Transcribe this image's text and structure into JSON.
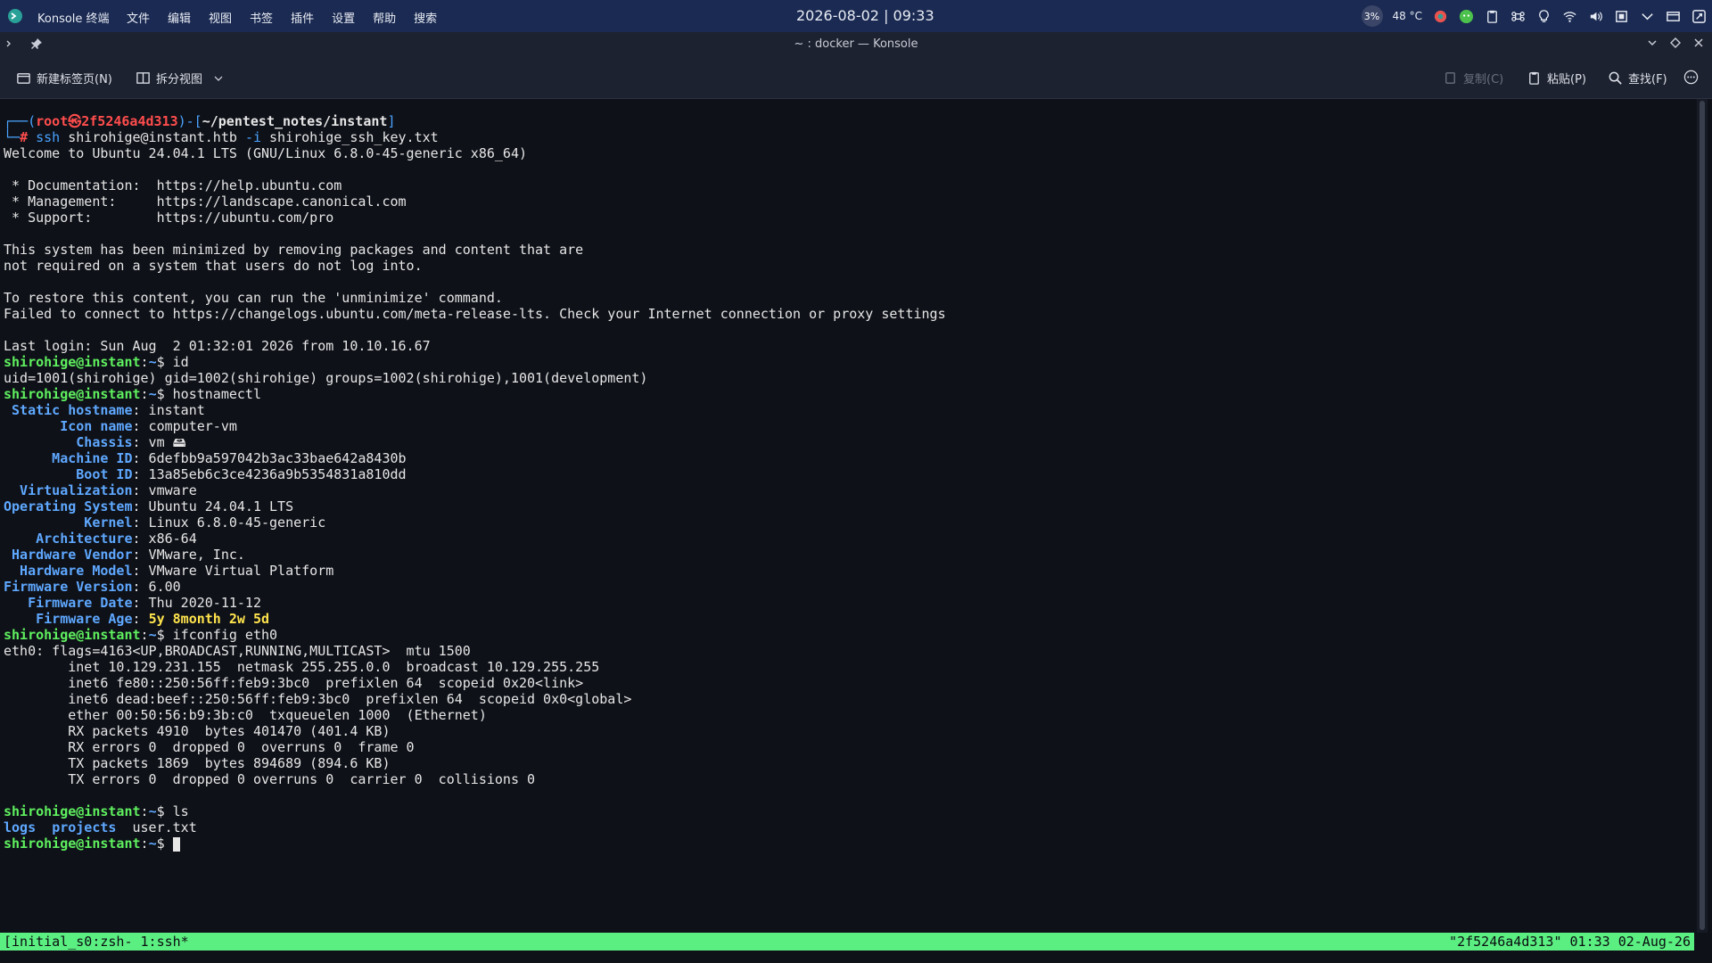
{
  "topbar": {
    "app_name": "Konsole 终端",
    "menus": [
      "文件",
      "编辑",
      "视图",
      "书签",
      "插件",
      "设置",
      "帮助",
      "搜索"
    ],
    "clock": "2026-08-02 | 09:33",
    "cpu": "3%",
    "temp": "48 °C",
    "tray_icons": [
      "color-picker-icon",
      "cat-icon",
      "clipboard-icon",
      "command-icon",
      "lightbulb-icon",
      "wifi-icon",
      "volume-icon",
      "chip-icon",
      "chevron-down-icon",
      "window-icon",
      "screenshot-icon"
    ]
  },
  "window": {
    "title": "~ : docker — Konsole"
  },
  "toolbar": {
    "new_tab": "新建标签页(N)",
    "split_view": "拆分视图",
    "copy": "复制(C)",
    "paste": "粘贴(P)",
    "find": "查找(F)"
  },
  "terminal": {
    "lines": [
      [
        [
          "c-blue",
          "┌──("
        ],
        [
          "c-red bold",
          "root㉿2f5246a4d313"
        ],
        [
          "c-blue",
          ")-["
        ],
        [
          "c-white bold",
          "~/pentest_notes/instant"
        ],
        [
          "c-blue",
          "]"
        ]
      ],
      [
        [
          "c-blue",
          "└─"
        ],
        [
          "c-red bold",
          "# "
        ],
        [
          "c-blue",
          "ssh "
        ],
        [
          "c-white",
          "shirohige@instant.htb "
        ],
        [
          "c-blue",
          "-i "
        ],
        [
          "c-white",
          "shirohige_ssh_key.txt"
        ]
      ],
      [
        [
          "c-white",
          "Welcome to Ubuntu 24.04.1 LTS (GNU/Linux 6.8.0-45-generic x86_64)"
        ]
      ],
      [
        [
          "c-white",
          ""
        ]
      ],
      [
        [
          "c-white",
          " * Documentation:  https://help.ubuntu.com"
        ]
      ],
      [
        [
          "c-white",
          " * Management:     https://landscape.canonical.com"
        ]
      ],
      [
        [
          "c-white",
          " * Support:        https://ubuntu.com/pro"
        ]
      ],
      [
        [
          "c-white",
          ""
        ]
      ],
      [
        [
          "c-white",
          "This system has been minimized by removing packages and content that are"
        ]
      ],
      [
        [
          "c-white",
          "not required on a system that users do not log into."
        ]
      ],
      [
        [
          "c-white",
          ""
        ]
      ],
      [
        [
          "c-white",
          "To restore this content, you can run the 'unminimize' command."
        ]
      ],
      [
        [
          "c-white",
          "Failed to connect to https://changelogs.ubuntu.com/meta-release-lts. Check your Internet connection or proxy settings"
        ]
      ],
      [
        [
          "c-white",
          ""
        ]
      ],
      [
        [
          "c-white",
          "Last login: Sun Aug  2 01:32:01 2026 from 10.10.16.67"
        ]
      ],
      [
        [
          "c-green",
          "shirohige@instant"
        ],
        [
          "c-white",
          ":"
        ],
        [
          "c-lblue",
          "~"
        ],
        [
          "c-white",
          "$ id"
        ]
      ],
      [
        [
          "c-white",
          "uid=1001(shirohige) gid=1002(shirohige) groups=1002(shirohige),1001(development)"
        ]
      ],
      [
        [
          "c-green",
          "shirohige@instant"
        ],
        [
          "c-white",
          ":"
        ],
        [
          "c-lblue",
          "~"
        ],
        [
          "c-white",
          "$ hostnamectl"
        ]
      ],
      [
        [
          "c-lblue",
          " Static hostname"
        ],
        [
          "c-white",
          ": instant"
        ]
      ],
      [
        [
          "c-lblue",
          "       Icon name"
        ],
        [
          "c-white",
          ": computer-vm"
        ]
      ],
      [
        [
          "c-lblue",
          "         Chassis"
        ],
        [
          "c-white",
          ": vm 🖴"
        ]
      ],
      [
        [
          "c-lblue",
          "      Machine ID"
        ],
        [
          "c-white",
          ": 6defbb9a597042b3ac33bae642a8430b"
        ]
      ],
      [
        [
          "c-lblue",
          "         Boot ID"
        ],
        [
          "c-white",
          ": 13a85eb6c3ce4236a9b5354831a810dd"
        ]
      ],
      [
        [
          "c-lblue",
          "  Virtualization"
        ],
        [
          "c-white",
          ": vmware"
        ]
      ],
      [
        [
          "c-lblue",
          "Operating System"
        ],
        [
          "c-white",
          ": Ubuntu 24.04.1 LTS"
        ]
      ],
      [
        [
          "c-lblue",
          "          Kernel"
        ],
        [
          "c-white",
          ": Linux 6.8.0-45-generic"
        ]
      ],
      [
        [
          "c-lblue",
          "    Architecture"
        ],
        [
          "c-white",
          ": x86-64"
        ]
      ],
      [
        [
          "c-lblue",
          " Hardware Vendor"
        ],
        [
          "c-white",
          ": VMware, Inc."
        ]
      ],
      [
        [
          "c-lblue",
          "  Hardware Model"
        ],
        [
          "c-white",
          ": VMware Virtual Platform"
        ]
      ],
      [
        [
          "c-lblue",
          "Firmware Version"
        ],
        [
          "c-white",
          ": 6.00"
        ]
      ],
      [
        [
          "c-lblue",
          "   Firmware Date"
        ],
        [
          "c-white",
          ": Thu 2020-11-12"
        ]
      ],
      [
        [
          "c-lblue",
          "    Firmware Age"
        ],
        [
          "c-white",
          ": "
        ],
        [
          "c-yellow",
          "5y 8month 2w 5d"
        ]
      ],
      [
        [
          "c-green",
          "shirohige@instant"
        ],
        [
          "c-white",
          ":"
        ],
        [
          "c-lblue",
          "~"
        ],
        [
          "c-white",
          "$ ifconfig eth0"
        ]
      ],
      [
        [
          "c-white",
          "eth0: flags=4163<UP,BROADCAST,RUNNING,MULTICAST>  mtu 1500"
        ]
      ],
      [
        [
          "c-white",
          "        inet 10.129.231.155  netmask 255.255.0.0  broadcast 10.129.255.255"
        ]
      ],
      [
        [
          "c-white",
          "        inet6 fe80::250:56ff:feb9:3bc0  prefixlen 64  scopeid 0x20<link>"
        ]
      ],
      [
        [
          "c-white",
          "        inet6 dead:beef::250:56ff:feb9:3bc0  prefixlen 64  scopeid 0x0<global>"
        ]
      ],
      [
        [
          "c-white",
          "        ether 00:50:56:b9:3b:c0  txqueuelen 1000  (Ethernet)"
        ]
      ],
      [
        [
          "c-white",
          "        RX packets 4910  bytes 401470 (401.4 KB)"
        ]
      ],
      [
        [
          "c-white",
          "        RX errors 0  dropped 0  overruns 0  frame 0"
        ]
      ],
      [
        [
          "c-white",
          "        TX packets 1869  bytes 894689 (894.6 KB)"
        ]
      ],
      [
        [
          "c-white",
          "        TX errors 0  dropped 0 overruns 0  carrier 0  collisions 0"
        ]
      ],
      [
        [
          "c-white",
          ""
        ]
      ],
      [
        [
          "c-green",
          "shirohige@instant"
        ],
        [
          "c-white",
          ":"
        ],
        [
          "c-lblue",
          "~"
        ],
        [
          "c-white",
          "$ ls"
        ]
      ],
      [
        [
          "c-lblue",
          "logs"
        ],
        [
          "c-white",
          "  "
        ],
        [
          "c-lblue",
          "projects"
        ],
        [
          "c-white",
          "  user.txt"
        ]
      ],
      [
        [
          "c-green",
          "shirohige@instant"
        ],
        [
          "c-white",
          ":"
        ],
        [
          "c-lblue",
          "~"
        ],
        [
          "c-white",
          "$ "
        ]
      ]
    ]
  },
  "statusbar": {
    "left": "[initial_s0:zsh- 1:ssh*",
    "right": "\"2f5246a4d313\" 01:33 02-Aug-26"
  },
  "colors": {
    "topbar": "#1b2a52",
    "terminal_bg": "#0e1118",
    "status_green": "#5bef82",
    "prompt_green": "#5ff05f",
    "label_blue": "#5fa8ff",
    "root_red": "#ff4d4d"
  }
}
